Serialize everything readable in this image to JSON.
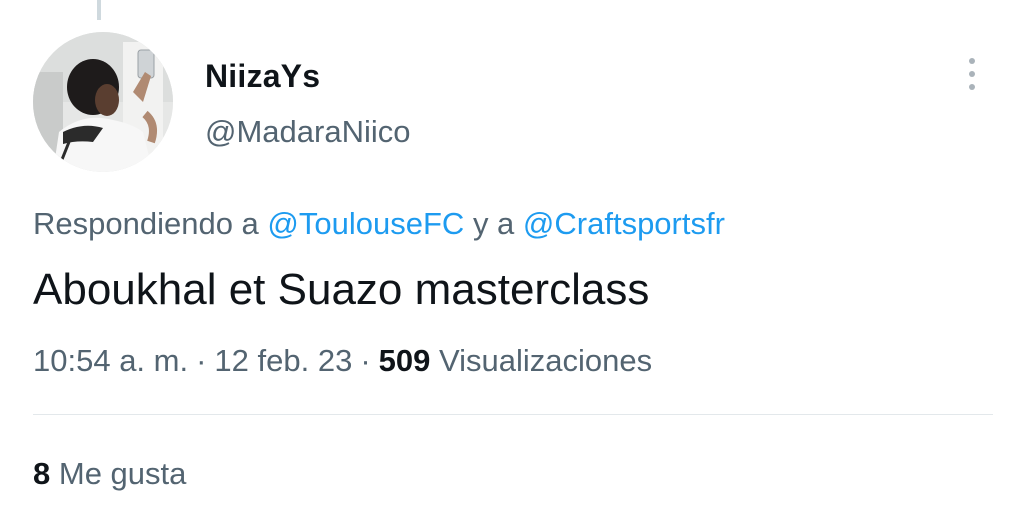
{
  "author": {
    "display_name": "NiizaYs",
    "handle": "@MadaraNiico"
  },
  "reply_context": {
    "prefix": "Respondiendo a",
    "mention_1": "@ToulouseFC",
    "conjunction": "y a",
    "mention_2": "@Craftsportsfr"
  },
  "tweet": {
    "text": "Aboukhal et Suazo masterclass"
  },
  "meta": {
    "time": "10:54 a. m.",
    "separator": "·",
    "date": "12 feb. 23",
    "views_count": "509",
    "views_label": "Visualizaciones"
  },
  "stats": {
    "likes_count": "8",
    "likes_label": "Me gusta"
  },
  "icons": {
    "more": "more-vertical-icon",
    "avatar": "user-avatar-photo"
  },
  "colors": {
    "text_primary": "#0f1419",
    "text_secondary": "#536471",
    "link": "#1d9bf0",
    "divider": "#e3e8eb"
  }
}
